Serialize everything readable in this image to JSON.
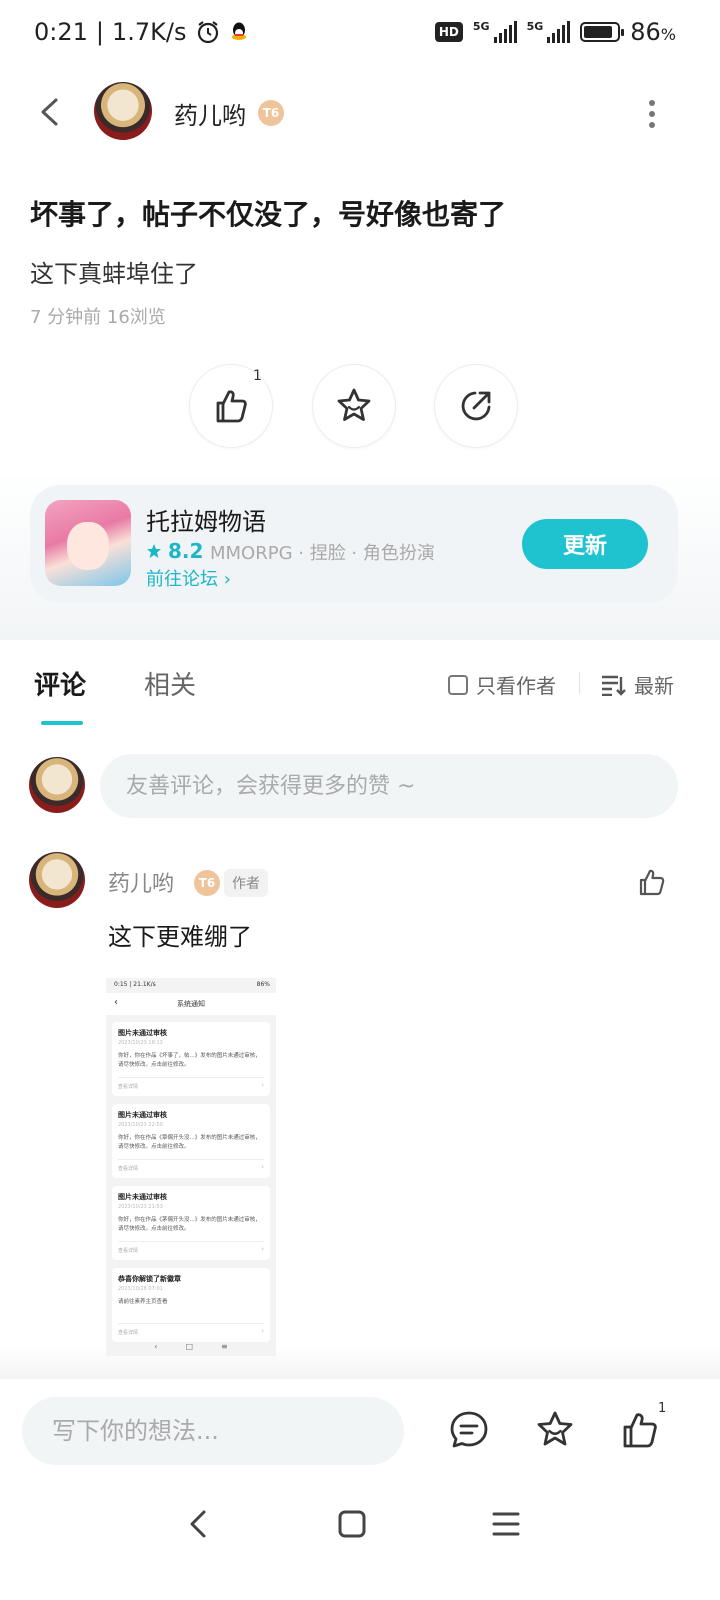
{
  "status_bar": {
    "time": "0:21",
    "speed": "1.7K/s",
    "network_badge": "HD",
    "network_1": "5G",
    "network_2": "5G",
    "battery_percent": "86",
    "battery_unit": "%",
    "battery_level": 0.86
  },
  "header": {
    "author_name": "药儿哟",
    "level_badge": "T6"
  },
  "post": {
    "title": "坏事了，帖子不仅没了，号好像也寄了",
    "body": "这下真蚌埠住了",
    "meta": "7 分钟前  16浏览",
    "like_count": "1"
  },
  "game": {
    "name": "托拉姆物语",
    "rating": "8.2",
    "tags": "MMORPG · 捏脸 · 角色扮演",
    "link_label": "前往论坛 ›",
    "update_label": "更新"
  },
  "tabs": {
    "comments": "评论",
    "related": "相关",
    "author_only": "只看作者",
    "sort": "最新"
  },
  "comment_input": {
    "placeholder": "友善评论，会获得更多的赞 ~"
  },
  "comment": {
    "author": "药儿哟",
    "level_badge": "T6",
    "author_tag": "作者",
    "text": "这下更难绷了"
  },
  "thumbnail": {
    "status_left": "0:15 | 21.1K/s",
    "status_right": "86%",
    "back": "‹",
    "title": "系统通知",
    "notices": [
      {
        "title": "图片未通过审核",
        "date": "2023/10/23 18:13",
        "body": "你好，你在作品《坏事了，帖...》发布的图片未通过审核，请尽快修改。点击前往修改。",
        "link": "查看详情"
      },
      {
        "title": "图片未通过审核",
        "date": "2023/10/23 22:50",
        "body": "你好，你在作品《章偶开头没...》发布的图片未通过审核，请尽快修改。点击前往修改。",
        "link": "查看详情"
      },
      {
        "title": "图片未通过审核",
        "date": "2023/10/23 21:53",
        "body": "你好，你在作品《茅偶开头没...》发布的图片未通过审核，请尽快修改。点击前往修改。",
        "link": "查看详情"
      },
      {
        "title": "恭喜你解锁了新徽章",
        "date": "2023/10/26 07:01",
        "body": "请前往素养主页查看",
        "link": "查看详情"
      }
    ],
    "nav_back": "‹",
    "nav_home": "□",
    "nav_menu": "≡"
  },
  "bottom_bar": {
    "placeholder": "写下你的想法...",
    "like_count": "1"
  },
  "colors": {
    "accent": "#1ec3cf",
    "accent_text": "#1cb6c8",
    "input_bg": "#f2f5f6",
    "level_badge": "#f0c49a"
  }
}
